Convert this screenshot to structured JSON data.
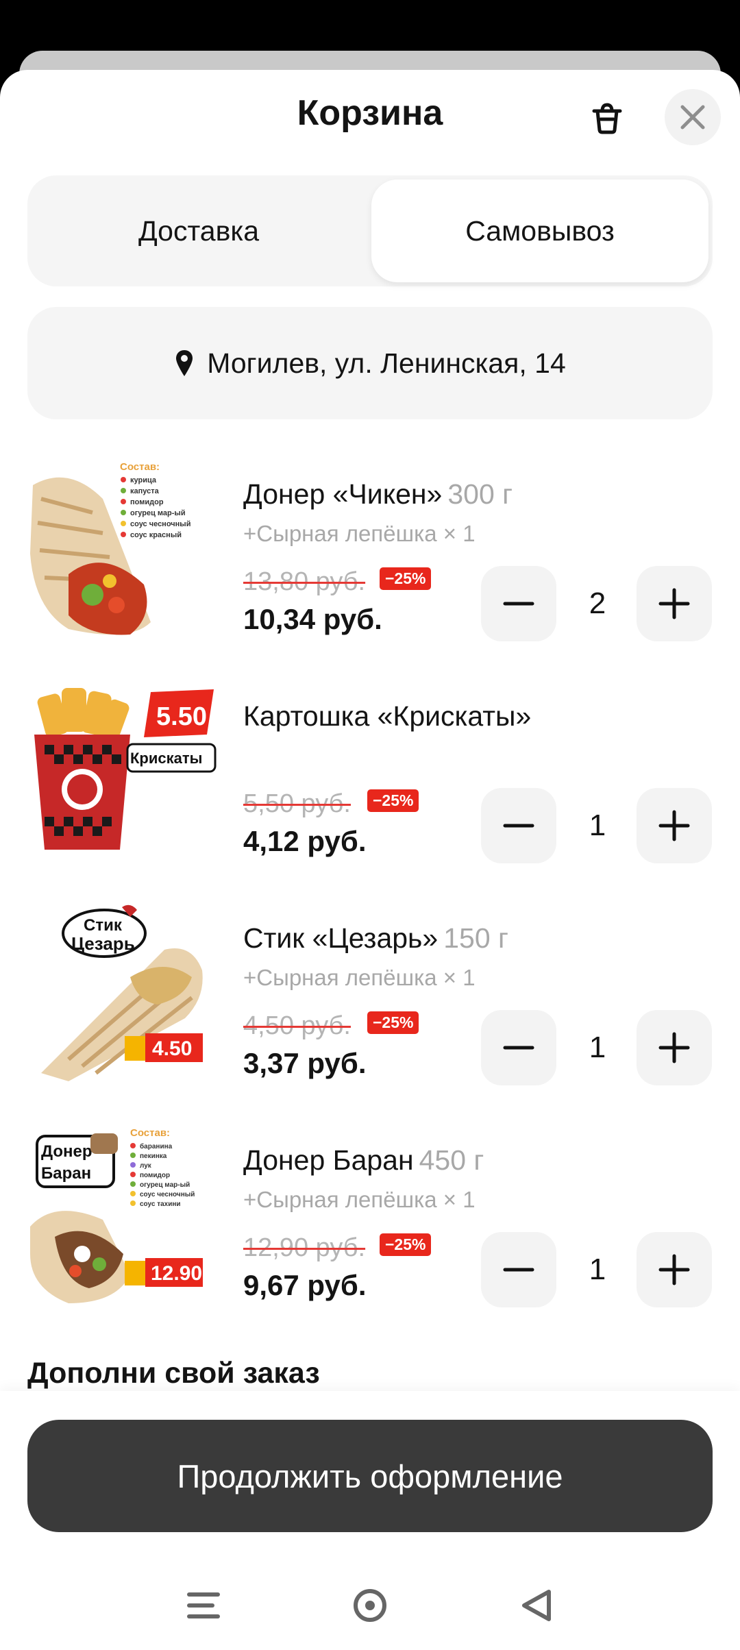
{
  "cart": {
    "title": "Корзина",
    "tabs": [
      {
        "label": "Доставка",
        "selected": false
      },
      {
        "label": "Самовывоз",
        "selected": true
      }
    ],
    "address": "Могилев, ул. Ленинская, 14",
    "items": [
      {
        "name": "Донер «Чикен»",
        "weight": "300 г",
        "addon": "+Сырная лепёшка × 1",
        "old_price": "13,80 руб.",
        "discount": "−25%",
        "price": "10,34 руб.",
        "quantity": "2",
        "image": "chicken-doner-image",
        "image_texts": [
          "Состав:",
          "курица",
          "капуста",
          "помидор",
          "огурец мар-ый",
          "соус чесночный",
          "соус красный"
        ]
      },
      {
        "name": "Картошка «Крискаты»",
        "weight": "",
        "addon": "",
        "old_price": "5,50 руб.",
        "discount": "−25%",
        "price": "4,12 руб.",
        "quantity": "1",
        "image": "fries-crisscut-image",
        "image_texts": [
          "5.50",
          "Крискаты"
        ]
      },
      {
        "name": "Стик «Цезарь»",
        "weight": "150 г",
        "addon": "+Сырная лепёшка × 1",
        "old_price": "4,50 руб.",
        "discount": "−25%",
        "price": "3,37 руб.",
        "quantity": "1",
        "image": "caesar-stick-image",
        "image_texts": [
          "Стик",
          "Цезарь",
          "4.50"
        ]
      },
      {
        "name": "Донер Баран",
        "weight": "450 г",
        "addon": "+Сырная лепёшка × 1",
        "old_price": "12,90 руб.",
        "discount": "−25%",
        "price": "9,67 руб.",
        "quantity": "1",
        "image": "lamb-doner-image",
        "image_texts": [
          "Донер",
          "Баран",
          "Состав:",
          "баранина",
          "пекинка",
          "лук",
          "помидор",
          "огурец мар-ый",
          "соус чесночный",
          "соус тахини",
          "12.90"
        ]
      }
    ],
    "upsell_title": "Дополни свой заказ",
    "continue_label": "Продолжить оформление"
  },
  "colors": {
    "accent_dark": "#3a3a3a",
    "discount_red": "#e8271c",
    "muted_text": "#a8a8a8",
    "panel_gray": "#f5f5f5"
  },
  "icons": [
    "trash-icon",
    "close-icon",
    "location-pin-icon",
    "minus-icon",
    "plus-icon",
    "menu-icon",
    "home-icon",
    "back-icon"
  ]
}
